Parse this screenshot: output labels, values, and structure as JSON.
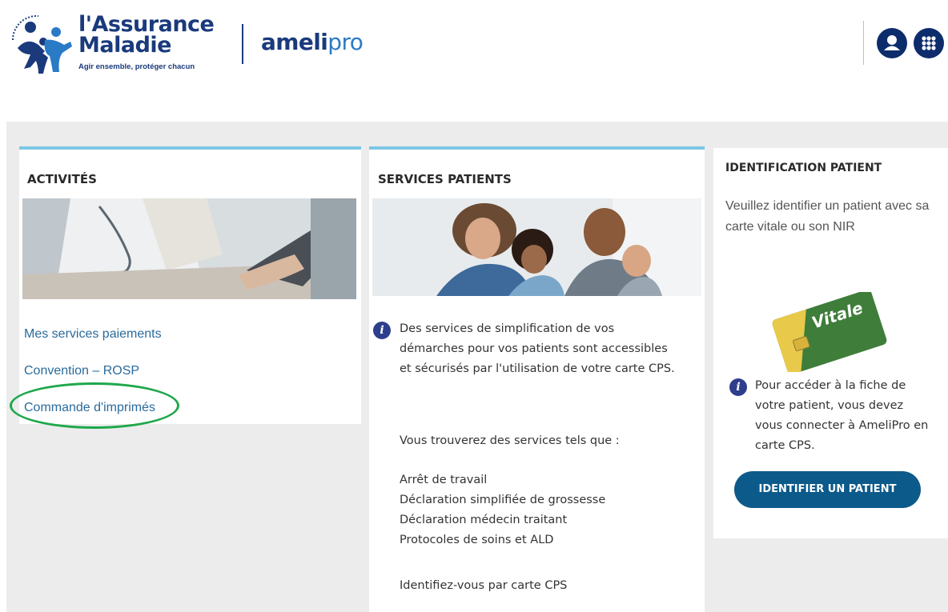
{
  "header": {
    "brand_line1": "l'Assurance",
    "brand_line2": "Maladie",
    "tagline": "Agir ensemble, protéger chacun",
    "product_part1": "ameli",
    "product_part2": "pro",
    "user_icon": "user-icon",
    "apps_icon": "apps-grid-icon"
  },
  "activites": {
    "title": "ACTIVITÉS",
    "links": [
      "Mes services paiements",
      "Convention – ROSP",
      "Commande d'imprimés"
    ],
    "highlighted": "Convention – ROSP"
  },
  "services_patients": {
    "title": "SERVICES PATIENTS",
    "intro": "Des services de simplification de vos démarches pour vos patients sont accessibles et sécurisés par l'utilisation de votre carte CPS.",
    "lead": "Vous trouverez des services tels que :",
    "services": [
      "Arrêt de travail",
      "Déclaration simplifiée de grossesse",
      "Déclaration médecin traitant",
      "Protocoles de soins et ALD"
    ],
    "footer": "Identifiez-vous par carte CPS"
  },
  "identification": {
    "title": "IDENTIFICATION PATIENT",
    "description": "Veuillez identifier un patient avec sa carte vitale ou son NIR",
    "card_label": "Vitale",
    "note": "Pour accéder à la fiche de votre patient, vous devez vous connecter à AmeliPro en carte CPS.",
    "button": "IDENTIFIER UN PATIENT"
  },
  "colors": {
    "brand_navy": "#1a3a7c",
    "brand_blue": "#2a7bc6",
    "accent_border": "#7cc7e4",
    "link": "#2a6b9c",
    "highlight_ring": "#1ea84a",
    "button": "#0c5a8a"
  }
}
